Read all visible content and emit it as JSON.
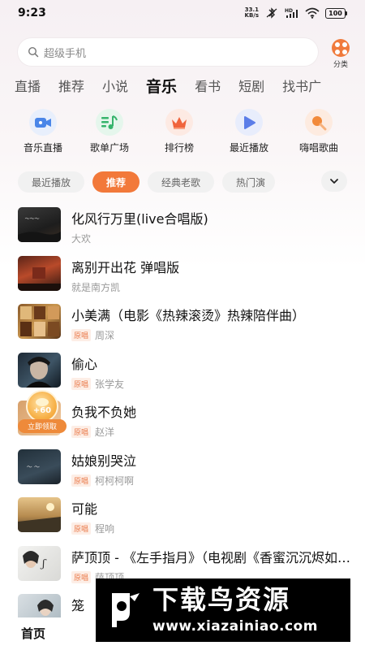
{
  "status_bar": {
    "time": "9:23",
    "net_speed_value": "33.1",
    "net_speed_unit": "KB/s",
    "battery": "100",
    "icons": [
      "bluetooth-icon",
      "hd-signal-icon",
      "wifi-icon",
      "battery-icon"
    ]
  },
  "search": {
    "placeholder": "超级手机",
    "category_label": "分类",
    "accent": "#f07a3c"
  },
  "tabs": [
    "直播",
    "推荐",
    "小说",
    "音乐",
    "看书",
    "短剧",
    "找书广"
  ],
  "active_tab": "音乐",
  "shortcuts": [
    {
      "label": "音乐直播",
      "icon": "video-camera-icon",
      "color": "#4a86e8"
    },
    {
      "label": "歌单广场",
      "icon": "music-note-icon",
      "color": "#36b46c"
    },
    {
      "label": "排行榜",
      "icon": "crown-icon",
      "color": "#f0643c"
    },
    {
      "label": "最近播放",
      "icon": "play-icon",
      "color": "#5b7de8"
    },
    {
      "label": "嗨唱歌曲",
      "icon": "microphone-icon",
      "color": "#f28a3a"
    }
  ],
  "chips": [
    "最近播放",
    "推荐",
    "经典老歌",
    "热门演"
  ],
  "active_chip": "推荐",
  "songs": [
    {
      "title": "化风行万里(live合唱版)",
      "artist": "大欢",
      "badge": ""
    },
    {
      "title": "离别开出花 弹唱版",
      "artist": "就是南方凯",
      "badge": ""
    },
    {
      "title": "小美满（电影《热辣滚烫》热辣陪伴曲）",
      "artist": "周深",
      "badge": "原唱"
    },
    {
      "title": "偷心",
      "artist": "张学友",
      "badge": "原唱"
    },
    {
      "title": "负我不负她",
      "artist": "赵洋",
      "badge": "原唱"
    },
    {
      "title": "姑娘别哭泣",
      "artist": "柯柯柯啊",
      "badge": "原唱"
    },
    {
      "title": "可能",
      "artist": "程响",
      "badge": "原唱"
    },
    {
      "title": "萨顶顶 - 《左手指月》（电视剧《香蜜沉沉烬如霜》片尾曲）",
      "artist": "萨顶顶",
      "badge": "原唱"
    },
    {
      "title": "笼",
      "artist": "",
      "badge": ""
    }
  ],
  "coin_reward": {
    "amount": "+60",
    "claim_label": "立即领取"
  },
  "bottom_nav": {
    "home": "首页"
  },
  "watermark": {
    "title": "下载鸟资源",
    "url": "www.xiazainiao.com"
  }
}
